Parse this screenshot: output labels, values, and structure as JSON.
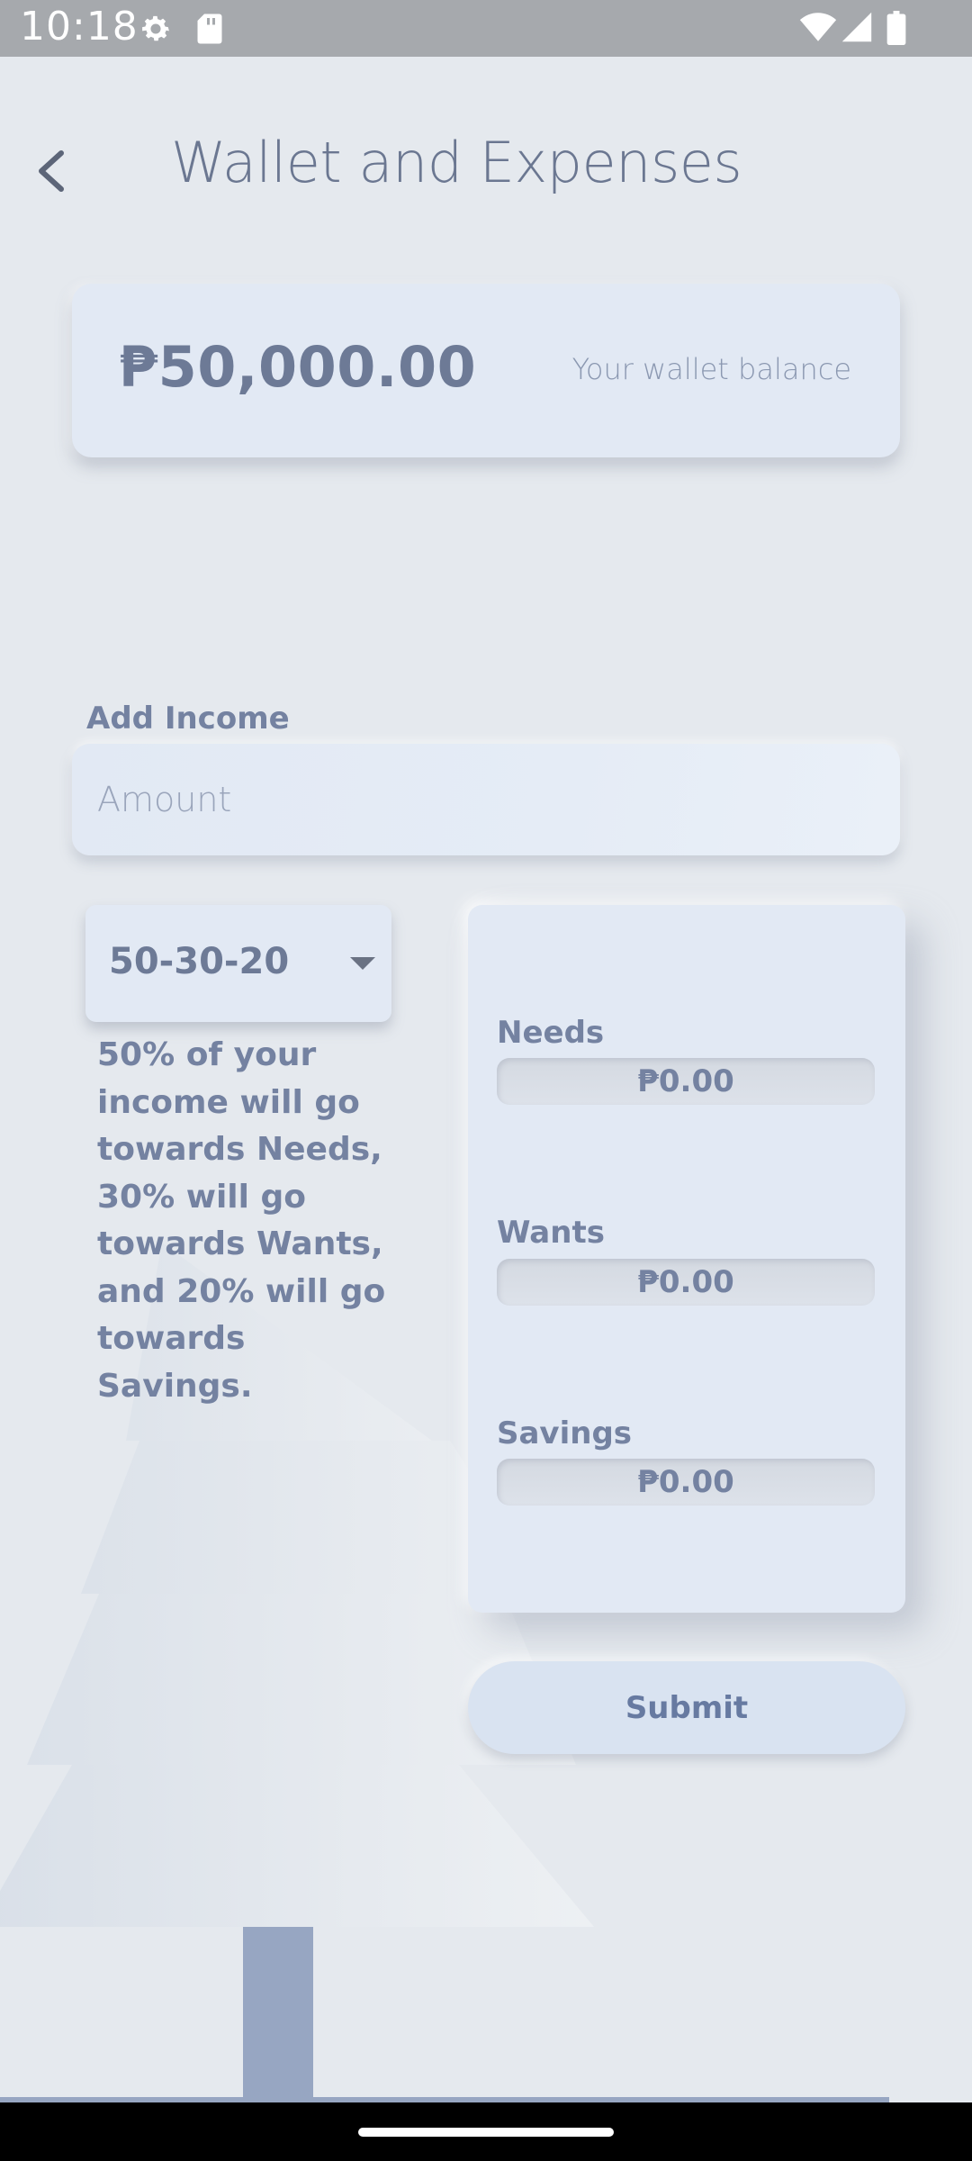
{
  "status_bar": {
    "time": "10:18",
    "icons": [
      "gear-icon",
      "sd-card-icon",
      "wifi-icon",
      "signal-icon",
      "battery-icon"
    ]
  },
  "header": {
    "title": "Wallet and Expenses",
    "back_icon": "chevron-left-icon"
  },
  "wallet": {
    "amount": "₱50,000.00",
    "caption": "Your wallet balance"
  },
  "income": {
    "label": "Add Income",
    "placeholder": "Amount",
    "value": ""
  },
  "ratio": {
    "selected": "50-30-20",
    "description": "50% of your income will go towards Needs, 30% will go towards Wants, and 20% will go towards Savings."
  },
  "allocations": [
    {
      "label": "Needs",
      "value": "₱0.00"
    },
    {
      "label": "Wants",
      "value": "₱0.00"
    },
    {
      "label": "Savings",
      "value": "₱0.00"
    }
  ],
  "submit_label": "Submit",
  "colors": {
    "background": "#e5e9ee",
    "card": "#e2e9f4",
    "text": "#6d7a96",
    "accent": "#677aa1",
    "tree_trunk": "#97a6c2"
  }
}
